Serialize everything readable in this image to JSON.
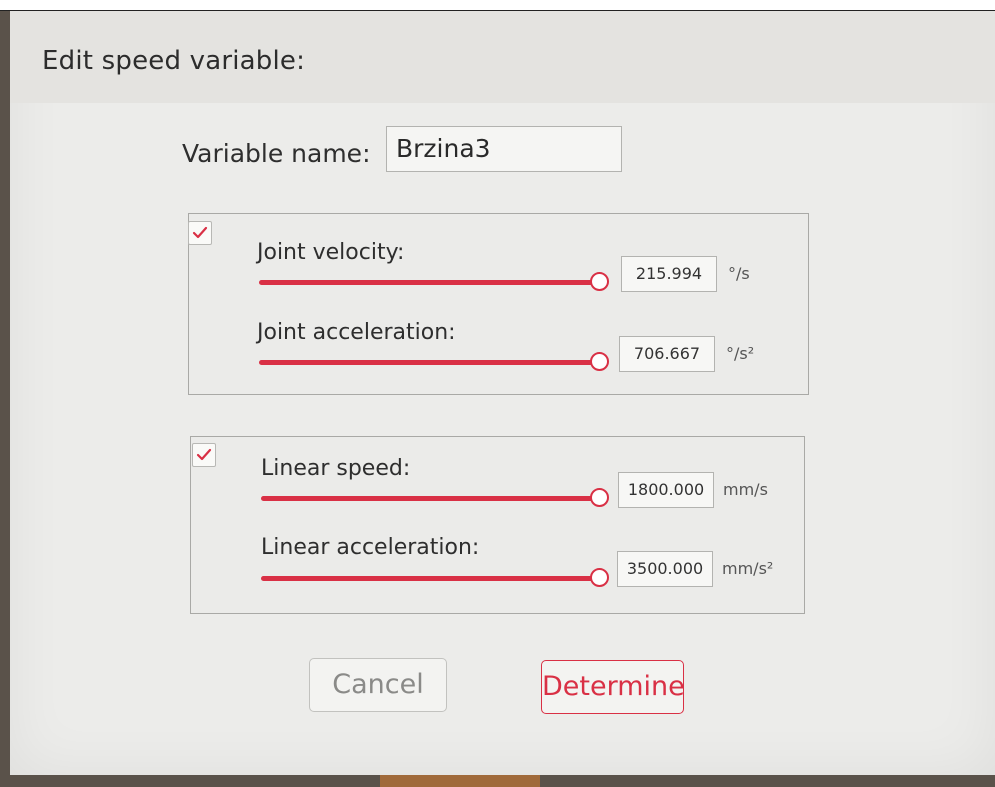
{
  "dialog": {
    "title": "Edit speed variable:"
  },
  "variable_name": {
    "label": "Variable name:",
    "value": "Brzina3"
  },
  "joint_group": {
    "enabled": true,
    "velocity": {
      "label": "Joint velocity:",
      "value": "215.994",
      "unit": "°/s",
      "level": 1.0
    },
    "acceleration": {
      "label": "Joint acceleration:",
      "value": "706.667",
      "unit": "°/s²",
      "level": 1.0
    }
  },
  "linear_group": {
    "enabled": true,
    "speed": {
      "label": "Linear speed:",
      "value": "1800.000",
      "unit": "mm/s",
      "level": 1.0
    },
    "acceleration": {
      "label": "Linear acceleration:",
      "value": "3500.000",
      "unit": "mm/s²",
      "level": 1.0
    }
  },
  "buttons": {
    "cancel": "Cancel",
    "determine": "Determine"
  },
  "colors": {
    "accent": "#d93045",
    "dialog_bg": "#ececea"
  },
  "icons": {
    "checkbox": "check-icon",
    "slider_thumb": "slider-thumb"
  }
}
